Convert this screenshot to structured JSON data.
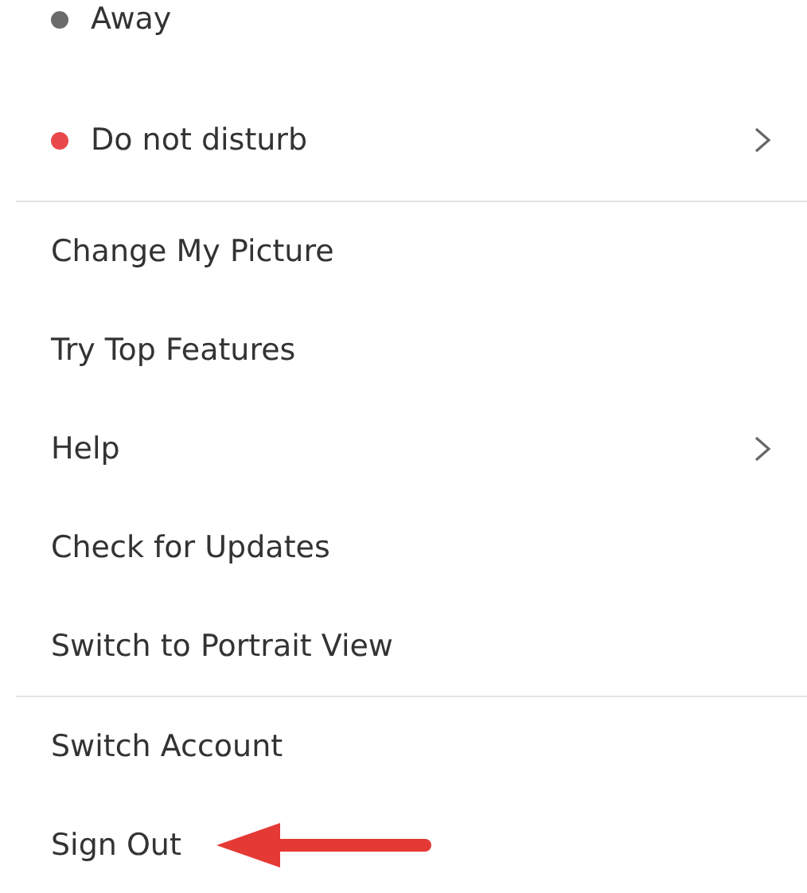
{
  "menu": {
    "sections": [
      {
        "items": [
          {
            "kind": "status",
            "label": "Away",
            "color": "#6b6b6b",
            "submenu": false,
            "arrow": false
          },
          {
            "kind": "status",
            "label": "Do not disturb",
            "color": "#e8474c",
            "submenu": true,
            "arrow": false
          }
        ]
      },
      {
        "items": [
          {
            "kind": "item",
            "label": "Change My Picture",
            "submenu": false,
            "arrow": false
          },
          {
            "kind": "item",
            "label": "Try Top Features",
            "submenu": false,
            "arrow": false
          },
          {
            "kind": "item",
            "label": "Help",
            "submenu": true,
            "arrow": false
          },
          {
            "kind": "item",
            "label": "Check for Updates",
            "submenu": false,
            "arrow": false
          },
          {
            "kind": "item",
            "label": "Switch to Portrait View",
            "submenu": false,
            "arrow": false
          }
        ]
      },
      {
        "items": [
          {
            "kind": "item",
            "label": "Switch Account",
            "submenu": false,
            "arrow": false
          },
          {
            "kind": "item",
            "label": "Sign Out",
            "submenu": false,
            "arrow": true
          }
        ]
      }
    ]
  }
}
